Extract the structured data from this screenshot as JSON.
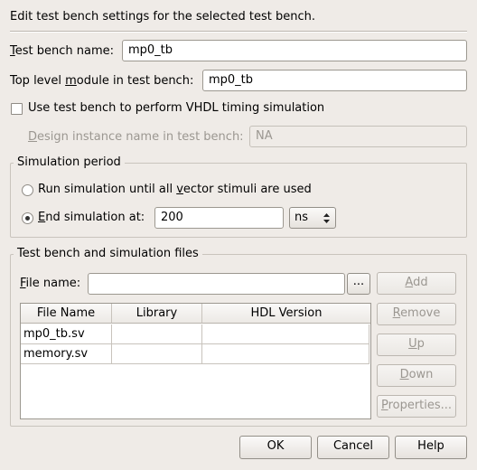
{
  "header": {
    "description": "Edit test bench settings for the selected test bench."
  },
  "test_bench_name": {
    "label_pre": "",
    "label_u": "T",
    "label_post": "est bench name:",
    "value": "mp0_tb"
  },
  "top_level_module": {
    "label_pre": "Top level ",
    "label_u": "m",
    "label_post": "odule in test bench:",
    "value": "mp0_tb"
  },
  "vhdl_timing": {
    "label": "Use test bench to perform VHDL timing simulation",
    "checked": false
  },
  "design_instance": {
    "label_pre": "",
    "label_u": "D",
    "label_post": "esign instance name in test bench:",
    "value": "NA"
  },
  "simulation_period": {
    "title": "Simulation period",
    "run_until": {
      "label_pre": "Run simulation until all ",
      "label_u": "v",
      "label_post": "ector stimuli are used"
    },
    "end_at": {
      "label_pre": "",
      "label_u": "E",
      "label_post": "nd simulation at:",
      "value": "200",
      "unit": "ns"
    }
  },
  "files": {
    "title": "Test bench and simulation files",
    "file_name": {
      "label_pre": "",
      "label_u": "F",
      "label_post": "ile name:",
      "value": ""
    },
    "browse_label": "...",
    "columns": [
      "File Name",
      "Library",
      "HDL Version"
    ],
    "rows": [
      {
        "file": "mp0_tb.sv",
        "library": "",
        "hdl": ""
      },
      {
        "file": "memory.sv",
        "library": "",
        "hdl": ""
      }
    ],
    "buttons": {
      "add": {
        "pre": "",
        "u": "A",
        "post": "dd"
      },
      "remove": {
        "pre": "",
        "u": "R",
        "post": "emove"
      },
      "up": {
        "pre": "",
        "u": "U",
        "post": "p"
      },
      "down": {
        "pre": "",
        "u": "D",
        "post": "own"
      },
      "properties": {
        "pre": "",
        "u": "P",
        "post": "roperties..."
      }
    }
  },
  "footer": {
    "ok": "OK",
    "cancel": "Cancel",
    "help": "Help"
  }
}
